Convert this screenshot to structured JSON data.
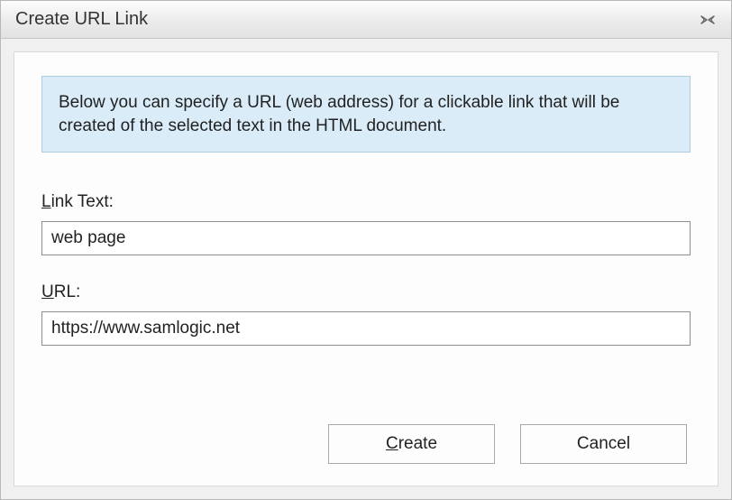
{
  "titlebar": {
    "title": "Create URL Link"
  },
  "info": {
    "text": "Below you can specify a URL (web address) for a clickable link that will be created of the selected text in the HTML document."
  },
  "fields": {
    "link_text": {
      "label_prefix": "L",
      "label_rest": "ink Text:",
      "value": "web page"
    },
    "url": {
      "label_prefix": "U",
      "label_rest": "RL:",
      "value": "https://www.samlogic.net"
    }
  },
  "buttons": {
    "create": {
      "prefix": "C",
      "rest": "reate"
    },
    "cancel": {
      "label": "Cancel"
    }
  }
}
